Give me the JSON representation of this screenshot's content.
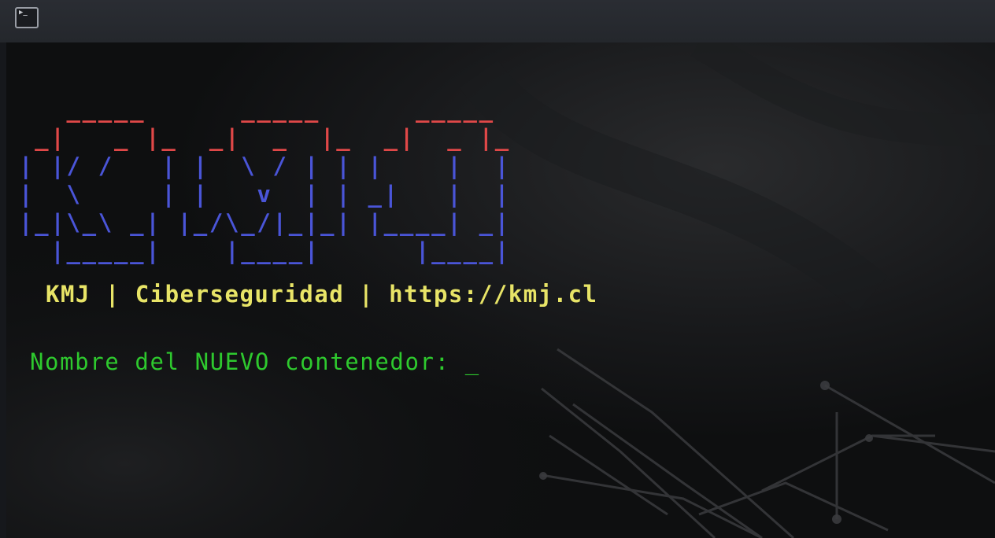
{
  "window": {
    "icon": "terminal-icon",
    "icon_glyph": "▶_"
  },
  "banner": {
    "line1": "   _____      _____      _____  ",
    "line2": " _|   _ |_  _|  _  |_  _|  _ |_",
    "line3": "| |/ /   | |  \\ / | | |    |  |",
    "line4": "|  \\     | |   v  | | _|   |  |",
    "line5": "|_|\\_\\ _| |_/\\_/|_|_| |____| _|",
    "line6": "  |_____|    |____|      |____|",
    "colors": {
      "top": "#e04848",
      "body": "#4a55d8"
    }
  },
  "tagline": "KMJ | Ciberseguridad | https://kmj.cl",
  "prompt": {
    "text": "Nombre del NUEVO contenedor: ",
    "cursor": "_"
  },
  "colors": {
    "tagline": "#e8e467",
    "prompt": "#2ec92e",
    "background": "#0e0f10"
  }
}
